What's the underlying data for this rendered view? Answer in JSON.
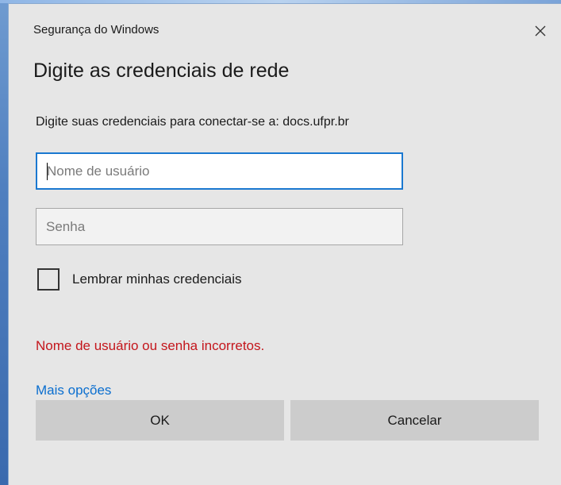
{
  "window": {
    "title": "Segurança do Windows",
    "close_icon": "close-icon"
  },
  "dialog": {
    "heading": "Digite as credenciais de rede",
    "prompt": "Digite suas credenciais para conectar-se a: docs.ufpr.br"
  },
  "form": {
    "username": {
      "placeholder": "Nome de usuário",
      "value": ""
    },
    "password": {
      "placeholder": "Senha",
      "value": ""
    },
    "remember": {
      "label": "Lembrar minhas credenciais",
      "checked": false
    }
  },
  "status": {
    "error_text": "Nome de usuário ou senha incorretos."
  },
  "links": {
    "more_options": "Mais opções"
  },
  "buttons": {
    "ok_label": "OK",
    "cancel_label": "Cancelar"
  },
  "colors": {
    "dialog_bg": "#e6e6e6",
    "accent": "#1a78d0",
    "error": "#c4161c",
    "link": "#0a6ecf",
    "button_bg": "#cccccc"
  }
}
